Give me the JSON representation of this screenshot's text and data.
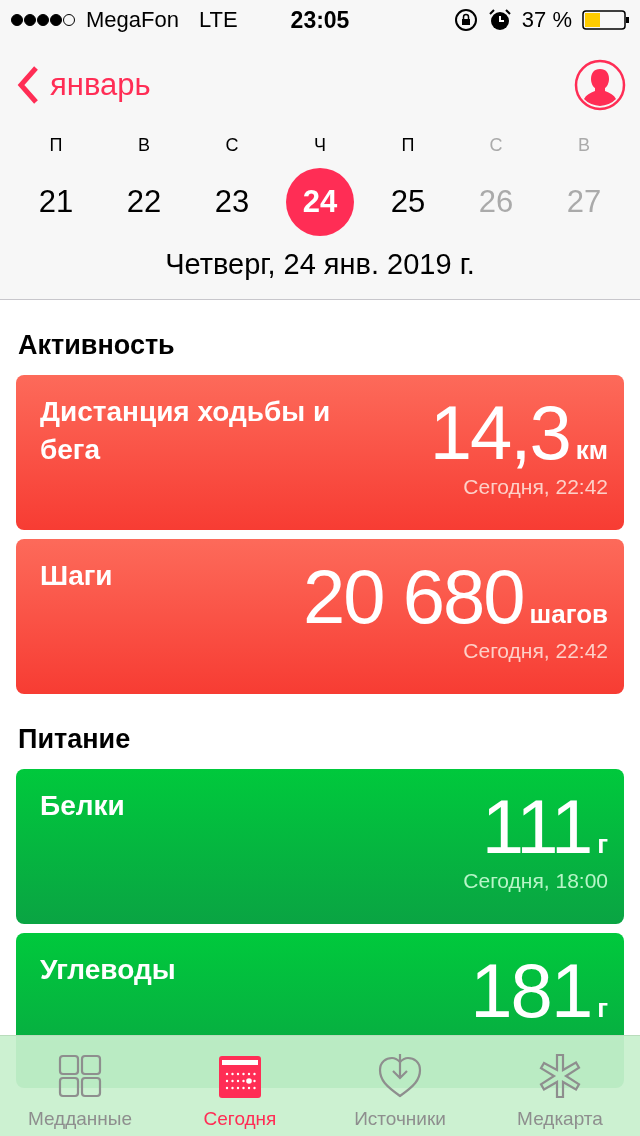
{
  "status_bar": {
    "carrier": "MegaFon",
    "network": "LTE",
    "time": "23:05",
    "battery": "37 %"
  },
  "nav": {
    "back": "январь"
  },
  "week": [
    {
      "letter": "П",
      "date": "21",
      "selected": false,
      "weekend": false
    },
    {
      "letter": "В",
      "date": "22",
      "selected": false,
      "weekend": false
    },
    {
      "letter": "С",
      "date": "23",
      "selected": false,
      "weekend": false
    },
    {
      "letter": "Ч",
      "date": "24",
      "selected": true,
      "weekend": false
    },
    {
      "letter": "П",
      "date": "25",
      "selected": false,
      "weekend": false
    },
    {
      "letter": "С",
      "date": "26",
      "selected": false,
      "weekend": true
    },
    {
      "letter": "В",
      "date": "27",
      "selected": false,
      "weekend": true
    }
  ],
  "date_line": "Четверг, 24 янв. 2019 г.",
  "sections": [
    {
      "title": "Активность",
      "cards": [
        {
          "kind": "activity",
          "title": "Дистанция ходьбы и бега",
          "value": "14,3",
          "unit": "км",
          "time": "Сегодня, 22:42"
        },
        {
          "kind": "activity",
          "title": "Шаги",
          "value": "20 680",
          "unit": "шагов",
          "time": "Сегодня, 22:42"
        }
      ]
    },
    {
      "title": "Питание",
      "cards": [
        {
          "kind": "nutrition",
          "title": "Белки",
          "value": "111",
          "unit": "г",
          "time": "Сегодня, 18:00"
        },
        {
          "kind": "nutrition",
          "title": "Углеводы",
          "value": "181",
          "unit": "г"
        }
      ]
    }
  ],
  "tabs": [
    {
      "label": "Медданные",
      "selected": false
    },
    {
      "label": "Сегодня",
      "selected": true
    },
    {
      "label": "Источники",
      "selected": false
    },
    {
      "label": "Медкарта",
      "selected": false
    }
  ]
}
